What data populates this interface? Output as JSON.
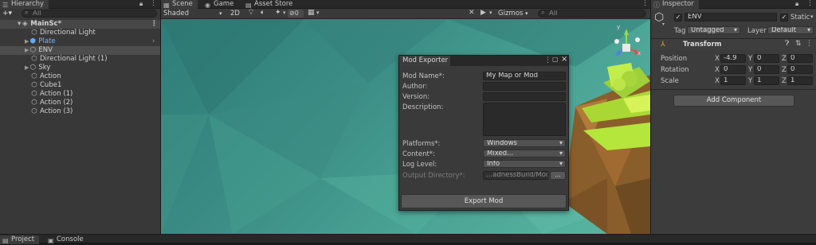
{
  "hierarchy": {
    "tab_label": "Hierarchy",
    "search_placeholder": "All",
    "add_label": "+▾",
    "items": [
      {
        "label": "MainSc*"
      },
      {
        "label": "Directional Light"
      },
      {
        "label": "Plate"
      },
      {
        "label": "ENV"
      },
      {
        "label": "Directional Light (1)"
      },
      {
        "label": "Sky"
      },
      {
        "label": "Action"
      },
      {
        "label": "Cube1"
      },
      {
        "label": "Action (1)"
      },
      {
        "label": "Action (2)"
      },
      {
        "label": "Action (3)"
      }
    ]
  },
  "scene_tabs": [
    {
      "label": "Scene"
    },
    {
      "label": "Game"
    },
    {
      "label": "Asset Store"
    }
  ],
  "scene_toolbar": {
    "shading_mode": "Shaded",
    "mode_2d": "2D",
    "hidden_count": "0",
    "gizmos_label": "Gizmos",
    "search_placeholder": "All"
  },
  "gizmo": {
    "x_label": "x",
    "y_label": "y"
  },
  "mod_exporter": {
    "title": "Mod Exporter",
    "fields": {
      "mod_name_label": "Mod Name*:",
      "mod_name_value": "My Map or Mod",
      "author_label": "Author:",
      "version_label": "Version:",
      "description_label": "Description:",
      "platforms_label": "Platforms*:",
      "platforms_value": "Windows",
      "content_label": "Content*:",
      "content_value": "Mixed...",
      "log_level_label": "Log Level:",
      "log_level_value": "Info",
      "output_dir_label": "Output Directory*:",
      "output_dir_value": "...adnessBuild/Mods",
      "browse_label": "..."
    },
    "export_button": "Export Mod"
  },
  "inspector": {
    "tab_label": "Inspector",
    "object_name": "ENV",
    "static_label": "Static",
    "tag_label": "Tag",
    "tag_value": "Untagged",
    "layer_label": "Layer",
    "layer_value": "Default",
    "transform": {
      "title": "Transform",
      "position": {
        "label": "Position",
        "x": "-4.9",
        "y": "0",
        "z": "0"
      },
      "rotation": {
        "label": "Rotation",
        "x": "0",
        "y": "0",
        "z": "0"
      },
      "scale": {
        "label": "Scale",
        "x": "1",
        "y": "1",
        "z": "1"
      }
    },
    "axis_x": "X",
    "axis_y": "Y",
    "axis_z": "Z",
    "add_component": "Add Component"
  },
  "bottom_tabs": [
    {
      "label": "Project"
    },
    {
      "label": "Console"
    }
  ],
  "colors": {
    "accent_blue": "#2c5d87",
    "prefab_blue": "#7cb4ff",
    "sky_teal": "#3a8c84",
    "grass_lime": "#b4e63c",
    "dirt_brown": "#9a6a32"
  }
}
